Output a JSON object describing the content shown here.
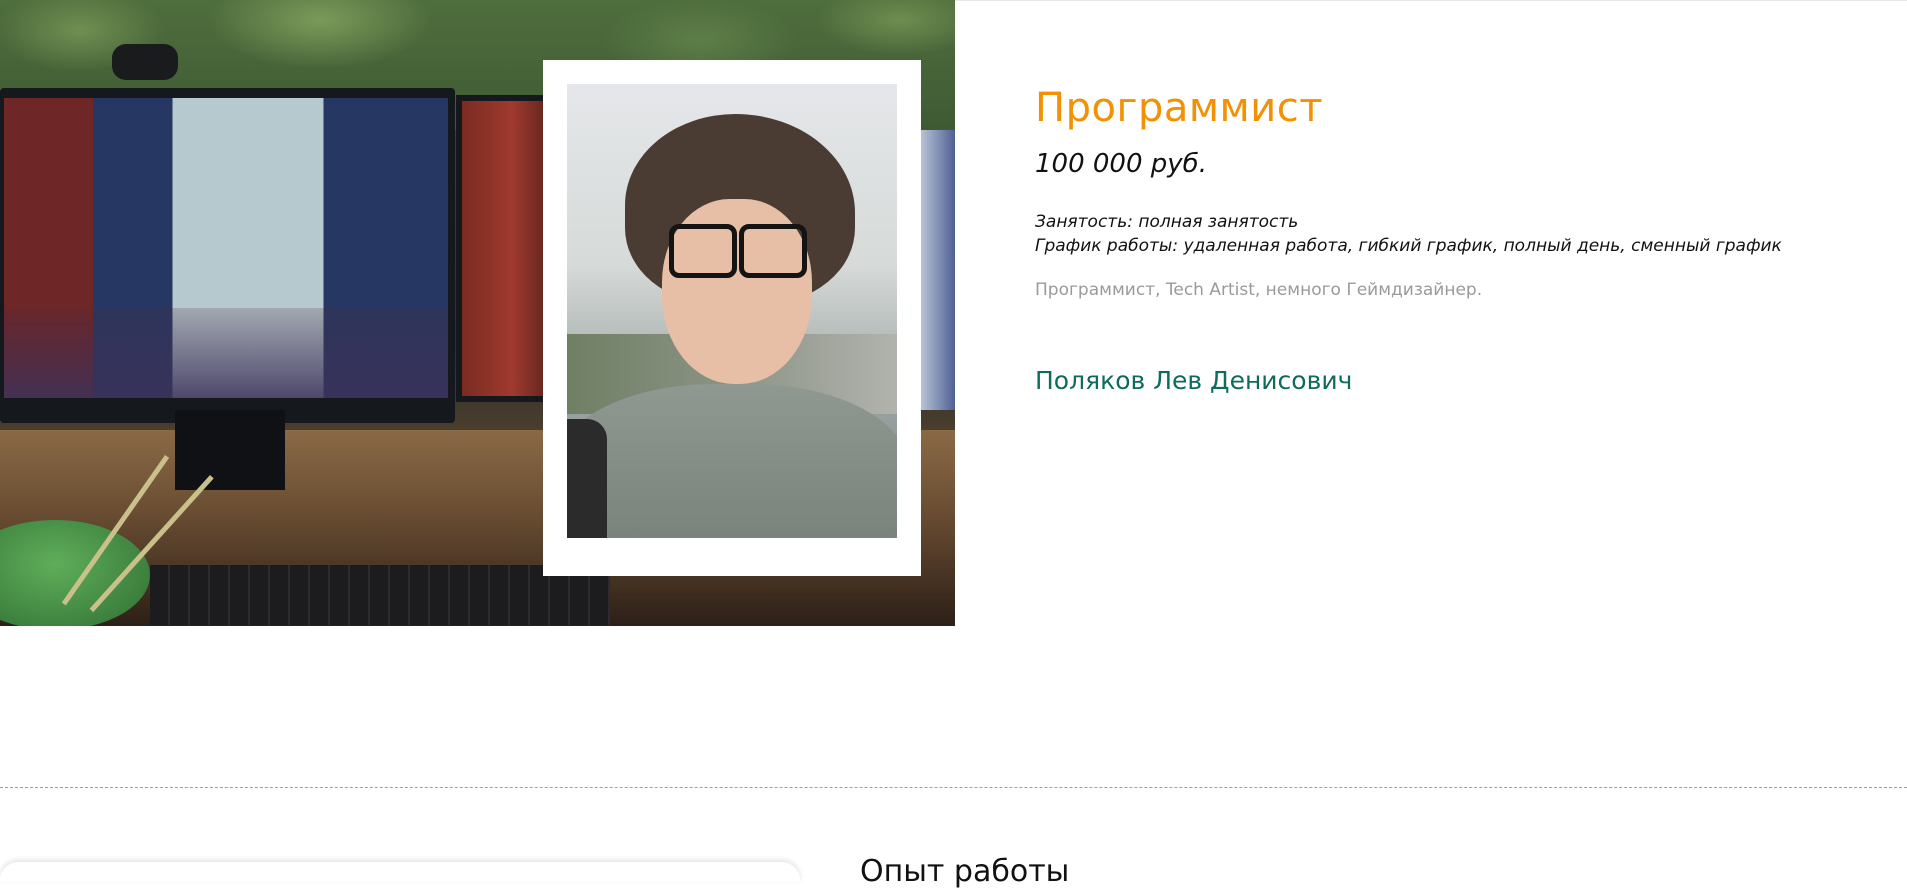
{
  "vacancy": {
    "title": "Программист",
    "salary": "100 000 руб.",
    "employment": "Занятость: полная занятость",
    "schedule": "График работы: удаленная работа, гибкий график, полный день, сменный график",
    "summary": "Программист, Tech Artist, немного Геймдизайнер.",
    "person_name": "Поляков Лев Денисович"
  },
  "bottom_section": {
    "heading": "Опыт работы"
  },
  "colors": {
    "title_accent": "#f39102",
    "name_accent": "#0f6b5c",
    "muted_text": "#9a9a9a"
  }
}
